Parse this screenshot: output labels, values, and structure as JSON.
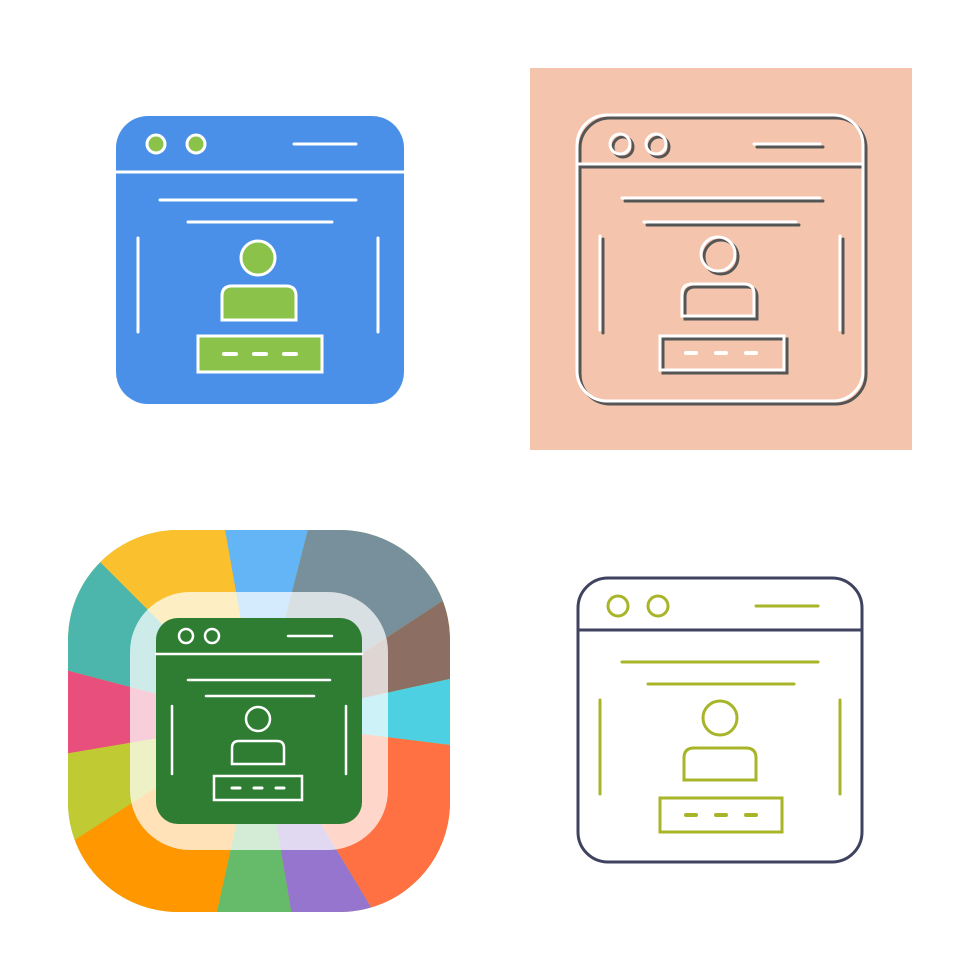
{
  "icons": [
    {
      "style": "glyph",
      "name": "web-login-icon",
      "colors": {
        "frame": "#4a90e8",
        "accent": "#8bc34a",
        "line": "#ffffff"
      }
    },
    {
      "style": "line-on-tile",
      "name": "web-login-icon",
      "colors": {
        "tile": "#f4c4ad",
        "line": "#ffffff",
        "shadow": "#555555"
      }
    },
    {
      "style": "colored-palette",
      "name": "web-login-icon",
      "colors": {
        "center": "#2e7d32",
        "line": "#ffffff",
        "segments": [
          "#fbc02d",
          "#64b5f6",
          "#78909c",
          "#8d6e63",
          "#4dd0e1",
          "#ff7043",
          "#9575cd",
          "#66bb6a",
          "#ff9800",
          "#c0ca33",
          "#e84f7d",
          "#4db6ac"
        ]
      }
    },
    {
      "style": "two-tone-outline",
      "name": "web-login-icon",
      "colors": {
        "frame": "#3f4360",
        "accent": "#a8b529"
      }
    }
  ]
}
